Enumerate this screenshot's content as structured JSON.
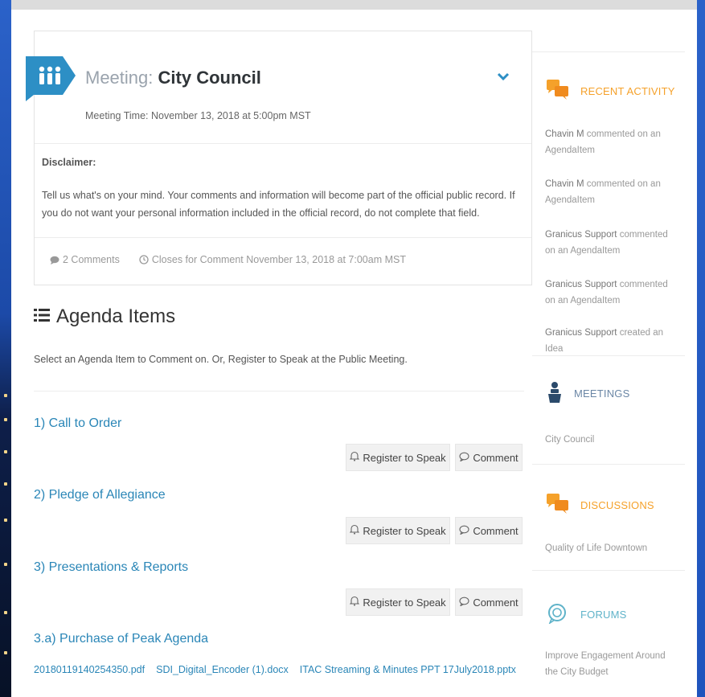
{
  "meeting": {
    "label": "Meeting:",
    "name": "City Council",
    "time": "Meeting Time: November 13, 2018 at 5:00pm MST",
    "disclaimer_heading": "Disclaimer:",
    "disclaimer_text": "Tell us what's on your mind. Your comments and information will become part of the official public record. If you do not want your personal information included in the official record, do not complete that field.",
    "comments_count": "2 Comments",
    "closes": "Closes for Comment November 13, 2018 at 7:00am MST"
  },
  "agenda": {
    "heading": "Agenda Items",
    "subheading": "Select an Agenda Item to Comment on. Or, Register to Speak at the Public Meeting.",
    "items": [
      {
        "title": "1) Call to Order",
        "register_label": "Register to Speak",
        "comment_label": "Comment"
      },
      {
        "title": "2) Pledge of Allegiance",
        "register_label": "Register to Speak",
        "comment_label": "Comment"
      },
      {
        "title": "3) Presentations & Reports",
        "register_label": "Register to Speak",
        "comment_label": "Comment"
      }
    ],
    "sub_item": {
      "title": "3.a) Purchase of Peak Agenda",
      "attachments": [
        "20180119140254350.pdf",
        "SDI_Digital_Encoder (1).docx",
        "ITAC Streaming & Minutes PPT 17July2018.pptx"
      ]
    }
  },
  "sidebar": {
    "recent_activity": {
      "title": "RECENT ACTIVITY",
      "entries": [
        {
          "who": "Chavin M",
          "what": "commented on an AgendaItem"
        },
        {
          "who": "Chavin M",
          "what": "commented on an AgendaItem"
        },
        {
          "who": "Granicus Support",
          "what": "commented on an AgendaItem"
        },
        {
          "who": "Granicus Support",
          "what": "commented on an AgendaItem"
        },
        {
          "who": "Granicus Support",
          "what": "created an Idea"
        }
      ]
    },
    "meetings": {
      "title": "MEETINGS",
      "item": "City Council"
    },
    "discussions": {
      "title": "DISCUSSIONS",
      "item": "Quality of Life Downtown"
    },
    "forums": {
      "title": "FORUMS",
      "item": "Improve Engagement Around the City Budget"
    }
  },
  "colors": {
    "link": "#2a86b7",
    "accent_orange": "#f5a12a",
    "flag_blue": "#2d8fc5"
  }
}
